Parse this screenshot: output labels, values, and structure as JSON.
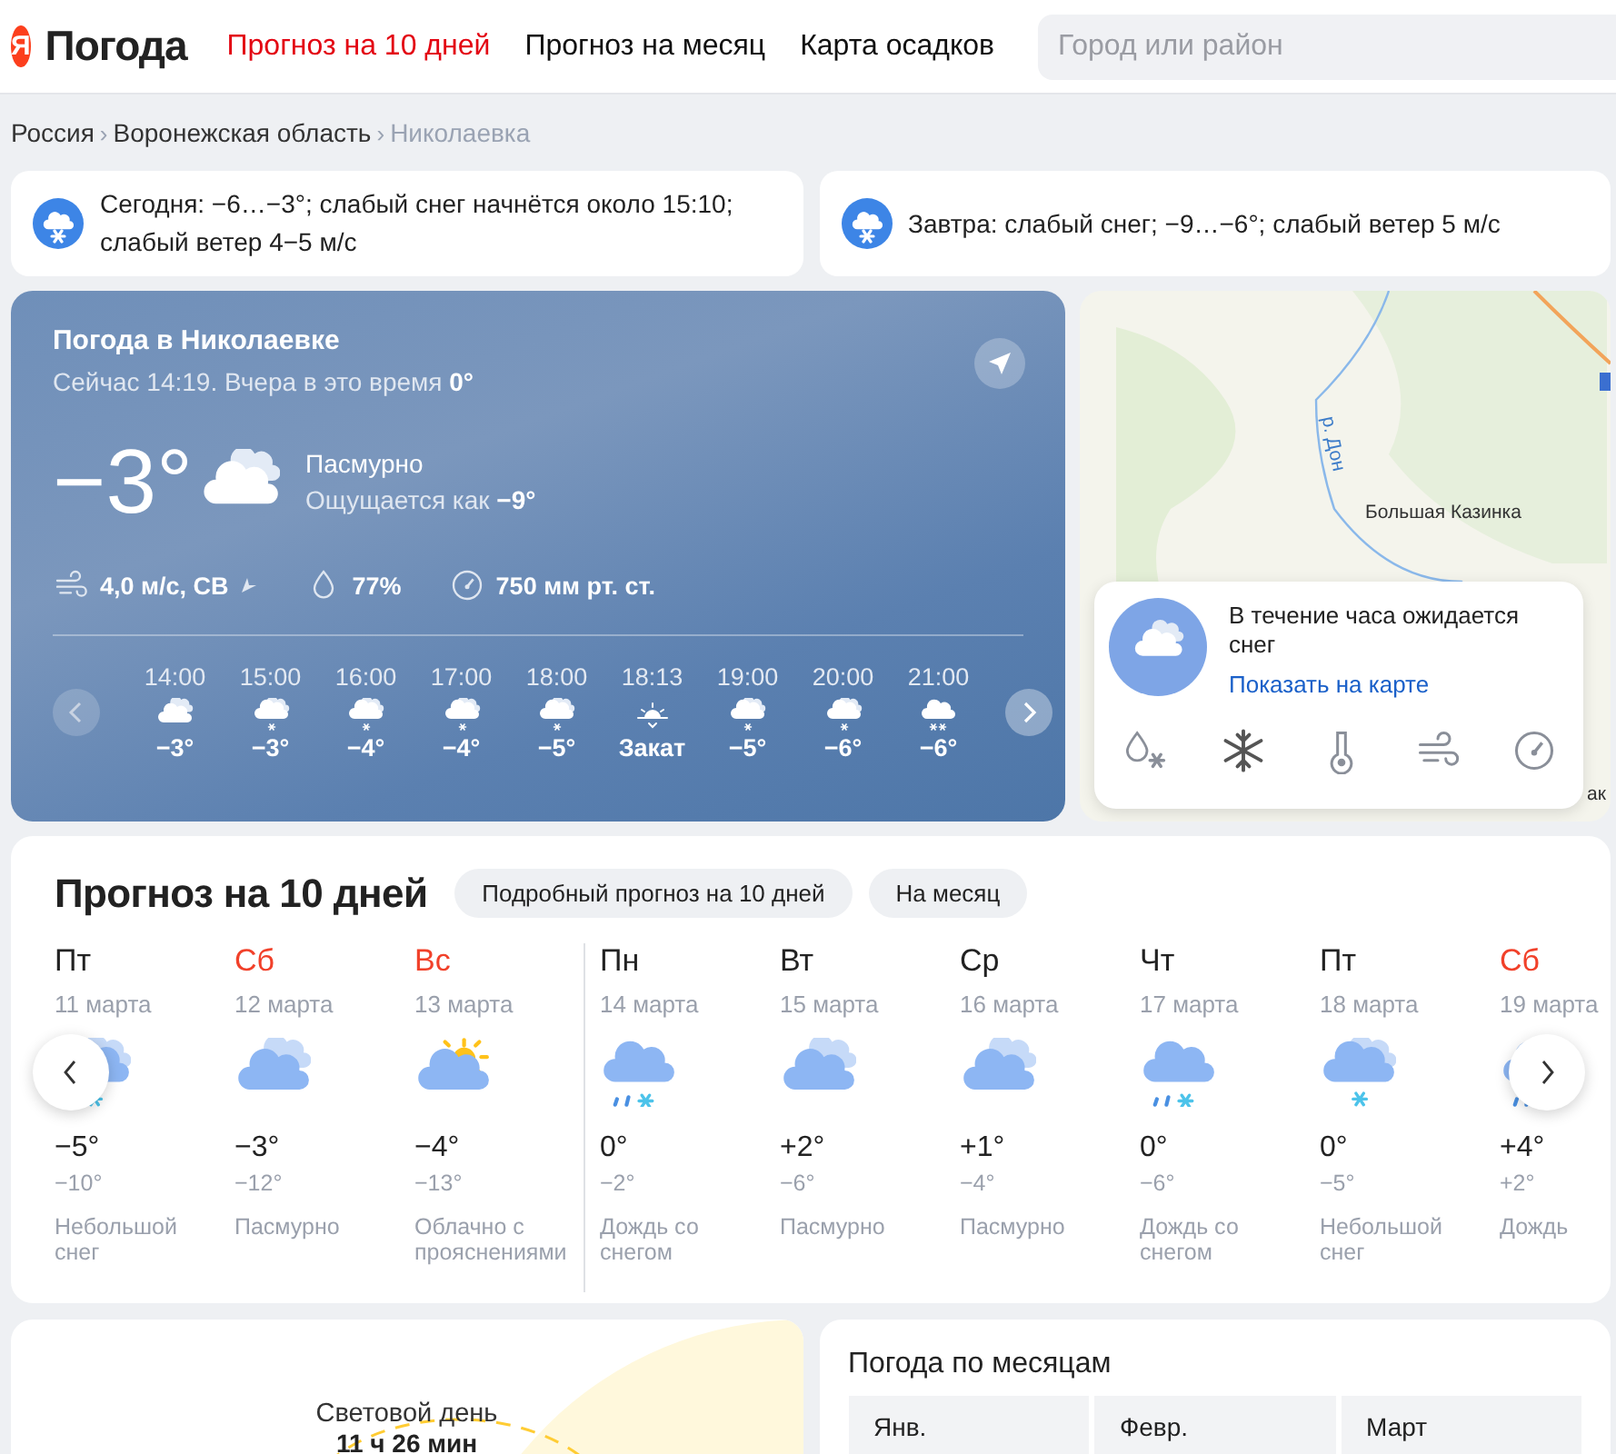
{
  "header": {
    "logo_letter": "Я",
    "logo_text": "Погода",
    "nav": [
      {
        "label": "Прогноз на 10 дней",
        "selected": true
      },
      {
        "label": "Прогноз на месяц",
        "selected": false
      },
      {
        "label": "Карта осадков",
        "selected": false
      }
    ],
    "search": {
      "placeholder": "Город или район"
    }
  },
  "breadcrumbs": [
    {
      "label": "Россия",
      "current": false
    },
    {
      "label": "Воронежская область",
      "current": false
    },
    {
      "label": "Николаевка",
      "current": true
    }
  ],
  "breadcrumb_separator": "›",
  "alerts": [
    {
      "text": "Сегодня: −6…−3°; слабый снег начнётся около 15:10; слабый ветер 4−5 м/с"
    },
    {
      "text": "Завтра: слабый снег; −9…−6°; слабый ветер 5 м/с"
    }
  ],
  "current": {
    "title": "Погода в Николаевке",
    "subtitle": "Сейчас 14:19. Вчера в это время **0°**",
    "temperature": "−3°",
    "condition": "Пасмурно",
    "feels_like": "Ощущается как **−9°**",
    "wind": "4,0 м/с, СВ",
    "humidity": "77%",
    "pressure": "750 мм рт. ст.",
    "hours": [
      {
        "time": "14:00",
        "kind": "partly-cloudy",
        "value": "−3°"
      },
      {
        "time": "15:00",
        "kind": "snow",
        "value": "−3°"
      },
      {
        "time": "16:00",
        "kind": "snow",
        "value": "−4°"
      },
      {
        "time": "17:00",
        "kind": "snow",
        "value": "−4°"
      },
      {
        "time": "18:00",
        "kind": "snow",
        "value": "−5°"
      },
      {
        "time": "18:13",
        "kind": "sunset",
        "value": "Закат"
      },
      {
        "time": "19:00",
        "kind": "snow",
        "value": "−5°"
      },
      {
        "time": "20:00",
        "kind": "snow",
        "value": "−6°"
      },
      {
        "time": "21:00",
        "kind": "heavy-snow",
        "value": "−6°"
      }
    ]
  },
  "map": {
    "labels": [
      {
        "text": "р. Дон",
        "kind": "river"
      },
      {
        "text": "Большая Казинка",
        "kind": "place"
      },
      {
        "text": "ак",
        "kind": "place"
      }
    ],
    "popup": {
      "text": "В течение часа ожидается снег",
      "link": "Показать на карте",
      "layers": [
        {
          "kind": "precipitation",
          "selected": false
        },
        {
          "kind": "snow",
          "selected": true
        },
        {
          "kind": "temperature",
          "selected": false
        },
        {
          "kind": "wind",
          "selected": false
        },
        {
          "kind": "pressure",
          "selected": false
        }
      ]
    }
  },
  "forecast": {
    "title": "Прогноз на 10 дней",
    "buttons": [
      "Подробный прогноз на 10 дней",
      "На месяц"
    ],
    "days": [
      {
        "weekday": "Пт",
        "date": "11 марта",
        "weekend": false,
        "kind": "snow",
        "max": "−5°",
        "min": "−10°",
        "description": "Небольшой снег"
      },
      {
        "weekday": "Сб",
        "date": "12 марта",
        "weekend": true,
        "kind": "overcast",
        "max": "−3°",
        "min": "−12°",
        "description": "Пасмурно"
      },
      {
        "weekday": "Вс",
        "date": "13 марта",
        "weekend": true,
        "kind": "partly-sunny",
        "max": "−4°",
        "min": "−13°",
        "description": "Облачно с прояснениями"
      },
      {
        "weekday": "Пн",
        "date": "14 марта",
        "weekend": false,
        "kind": "rain-snow",
        "max": "0°",
        "min": "−2°",
        "description": "Дождь со снегом"
      },
      {
        "weekday": "Вт",
        "date": "15 марта",
        "weekend": false,
        "kind": "overcast",
        "max": "+2°",
        "min": "−6°",
        "description": "Пасмурно"
      },
      {
        "weekday": "Ср",
        "date": "16 марта",
        "weekend": false,
        "kind": "overcast",
        "max": "+1°",
        "min": "−4°",
        "description": "Пасмурно"
      },
      {
        "weekday": "Чт",
        "date": "17 марта",
        "weekend": false,
        "kind": "rain-snow",
        "max": "0°",
        "min": "−6°",
        "description": "Дождь со снегом"
      },
      {
        "weekday": "Пт",
        "date": "18 марта",
        "weekend": false,
        "kind": "snow",
        "max": "0°",
        "min": "−5°",
        "description": "Небольшой снег"
      },
      {
        "weekday": "Сб",
        "date": "19 марта",
        "weekend": true,
        "kind": "rain",
        "max": "+4°",
        "min": "+2°",
        "description": "Дождь"
      }
    ]
  },
  "daylight": {
    "title": "Световой день",
    "value": "11 ч 26 мин"
  },
  "months": {
    "title": "Погода по месяцам",
    "columns": [
      "Янв.",
      "Февр.",
      "Март"
    ]
  }
}
